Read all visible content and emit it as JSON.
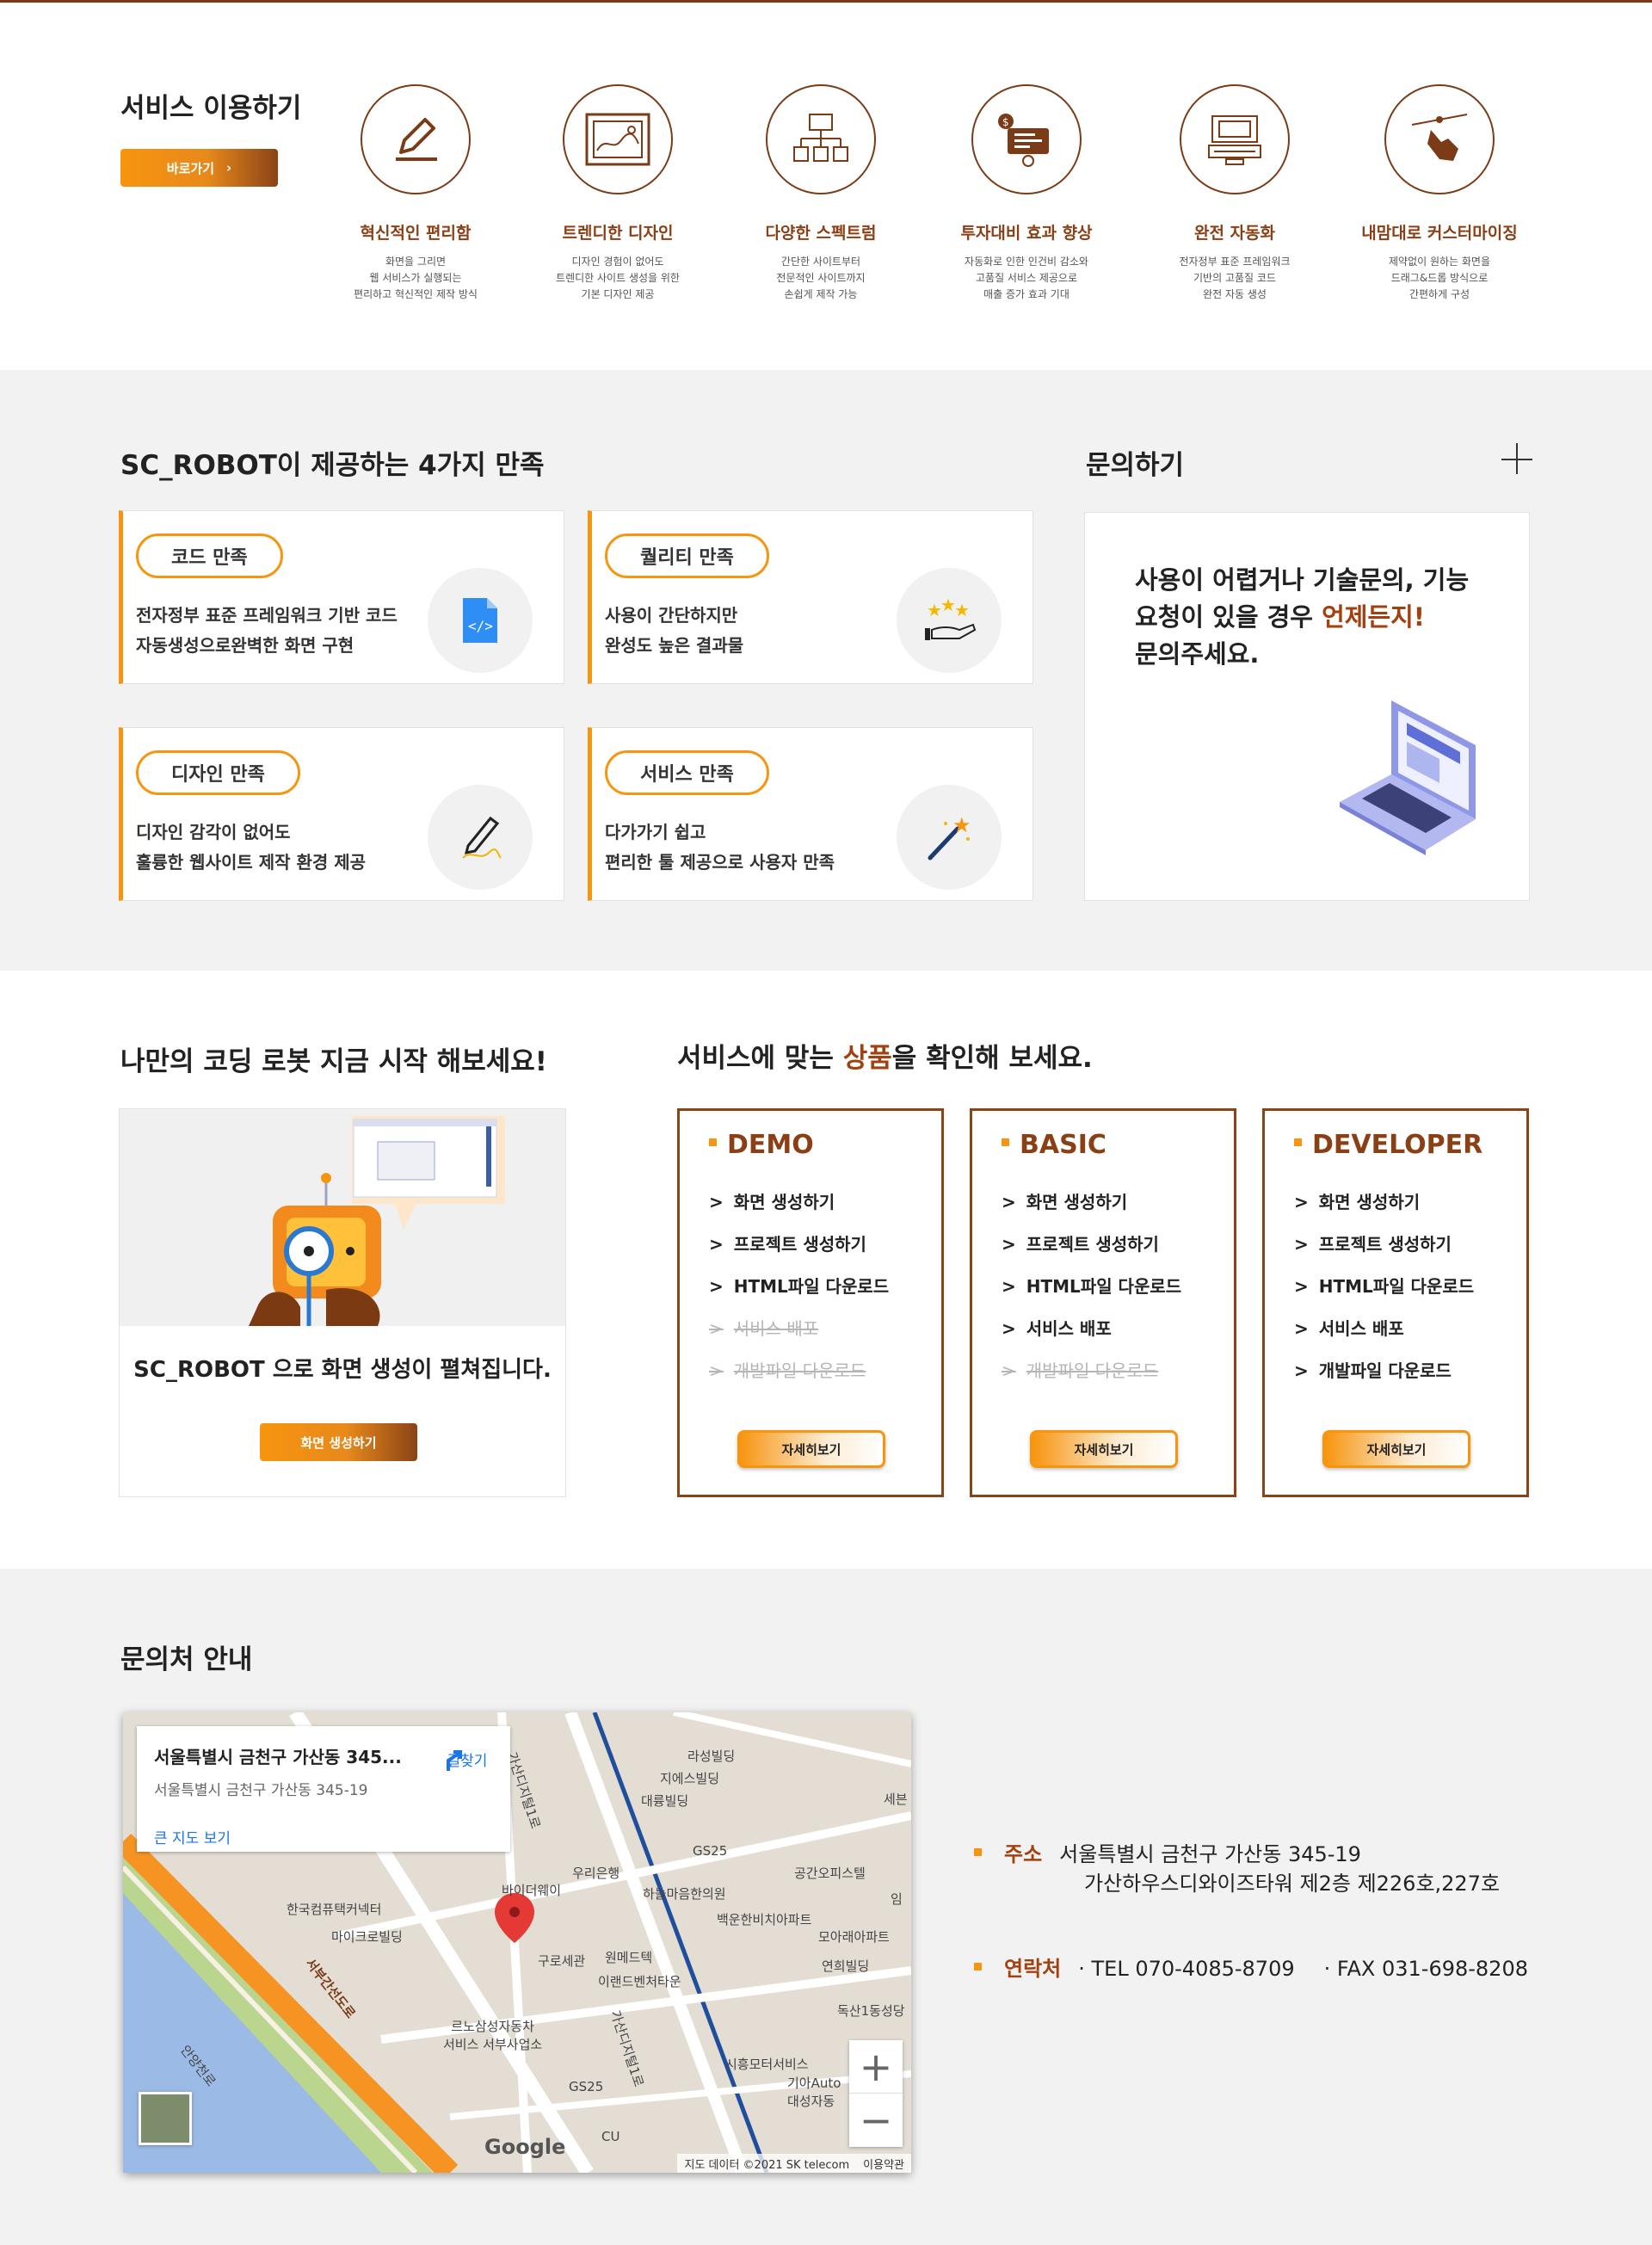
{
  "services": {
    "title": "서비스 이용하기",
    "go_button": "바로가기",
    "go_arrow": "›",
    "features": [
      {
        "icon": "pen-icon",
        "title": "혁신적인 편리함",
        "desc": "화면을 그리면\n웹 서비스가 실행되는\n편리하고 혁신적인 제작 방식"
      },
      {
        "icon": "image-frame-icon",
        "title": "트렌디한 디자인",
        "desc": "디자인 경험이 없어도\n트렌디한 사이트 생성을 위한\n기본 디자인 제공"
      },
      {
        "icon": "sitemap-icon",
        "title": "다양한 스펙트럼",
        "desc": "간단한 사이트부터\n전문적인 사이트까지\n손쉽게 제작 가능"
      },
      {
        "icon": "money-robot-icon",
        "title": "투자대비 효과 향상",
        "desc": "자동화로 인한 인건비 감소와\n고품질 서비스 제공으로\n매출 증가 효과 기대"
      },
      {
        "icon": "automation-machine-icon",
        "title": "완전 자동화",
        "desc": "전자정부 표준 프레임워크\n기반의 고품질 코드\n완전 자동 생성"
      },
      {
        "icon": "hand-drag-icon",
        "title": "내맘대로 커스터마이징",
        "desc": "제약없이 원하는 화면을\n드래그&드롭 방식으로\n간편하게 구성"
      }
    ]
  },
  "satisfaction": {
    "title": "SC_ROBOT이 제공하는 4가지 만족",
    "cards": [
      {
        "label": "코드 만족",
        "desc": "전자정부 표준 프레임워크 기반 코드\n자동생성으로완벽한 화면 구현",
        "icon": "code-file-icon"
      },
      {
        "label": "퀄리티 만족",
        "desc": "사용이 간단하지만\n완성도 높은 결과물",
        "icon": "stars-hand-icon"
      },
      {
        "label": "디자인 만족",
        "desc": "디자인 감각이 없어도\n훌륭한 웹사이트 제작 환경 제공",
        "icon": "pencil-icon"
      },
      {
        "label": "서비스 만족",
        "desc": "다가가기 쉽고\n편리한 툴 제공으로 사용자 만족",
        "icon": "magic-wand-icon"
      }
    ]
  },
  "inquiry": {
    "title": "문의하기",
    "line1": "사용이 어렵거나 기술문의, 기능",
    "line2a": "요청이 있을 경우 ",
    "line2b": "언제든지!",
    "line3": "문의주세요."
  },
  "start": {
    "title": "나만의 코딩 로봇 지금 시작 해보세요!",
    "caption": "SC_ROBOT 으로 화면 생성이 펼쳐집니다.",
    "button": "화면 생성하기"
  },
  "products": {
    "title_a": "서비스에 맞는 ",
    "title_b": "상품",
    "title_c": "을 확인해 보세요.",
    "detail_button": "자세히보기",
    "plans": [
      {
        "name": "DEMO",
        "features": [
          {
            "label": "화면 생성하기",
            "enabled": true
          },
          {
            "label": "프로젝트 생성하기",
            "enabled": true
          },
          {
            "label": "HTML파일 다운로드",
            "enabled": true
          },
          {
            "label": "서비스 배포",
            "enabled": false
          },
          {
            "label": "개발파일 다운로드",
            "enabled": false
          }
        ]
      },
      {
        "name": "BASIC",
        "features": [
          {
            "label": "화면 생성하기",
            "enabled": true
          },
          {
            "label": "프로젝트 생성하기",
            "enabled": true
          },
          {
            "label": "HTML파일 다운로드",
            "enabled": true
          },
          {
            "label": "서비스 배포",
            "enabled": true
          },
          {
            "label": "개발파일 다운로드",
            "enabled": false
          }
        ]
      },
      {
        "name": "DEVELOPER",
        "features": [
          {
            "label": "화면 생성하기",
            "enabled": true
          },
          {
            "label": "프로젝트 생성하기",
            "enabled": true
          },
          {
            "label": "HTML파일 다운로드",
            "enabled": true
          },
          {
            "label": "서비스 배포",
            "enabled": true
          },
          {
            "label": "개발파일 다운로드",
            "enabled": true
          }
        ]
      }
    ]
  },
  "contact": {
    "title": "문의처 안내",
    "map": {
      "place_name": "서울특별시 금천구 가산동 345...",
      "place_address": "서울특별시 금천구 가산동 345-19",
      "directions": "길찾기",
      "larger_map": "큰 지도 보기",
      "zoom_in": "+",
      "zoom_out": "−",
      "logo": "Google",
      "attribution": "지도 데이터 ©2021 SK telecom",
      "terms": "이용약관",
      "labels": [
        "라성빌딩",
        "지에스빌딩",
        "대륭빌딩",
        "GS25",
        "우리은행",
        "바이더웨이",
        "하늘마음한의원",
        "공간오피스텔",
        "한국컴퓨택커넥터",
        "마이크로빌딩",
        "백운한비치아파트",
        "모아래아파트",
        "구로세관",
        "원메드텍",
        "이랜드벤처타운",
        "연희빌딩",
        "독산1동성당",
        "르노삼성자동차\n서비스 서부사업소",
        "시흥모터서비스",
        "기아Auto\n대성자동",
        "GS25",
        "CU",
        "서부간선도로",
        "가산디지털1로",
        "가산디지털1로",
        "안양천로",
        "세븐",
        "임"
      ]
    },
    "address_label": "주소",
    "address_line1": "서울특별시 금천구 가산동 345-19",
    "address_line2": "가산하우스디와이즈타워 제2층 제226호,227호",
    "phone_label": "연락처",
    "tel": "· TEL 070-4085-8709",
    "fax": "· FAX 031-698-8208"
  },
  "colors": {
    "accent": "#f7950f",
    "brand": "#8a3f15",
    "highlight": "#a2410f"
  }
}
